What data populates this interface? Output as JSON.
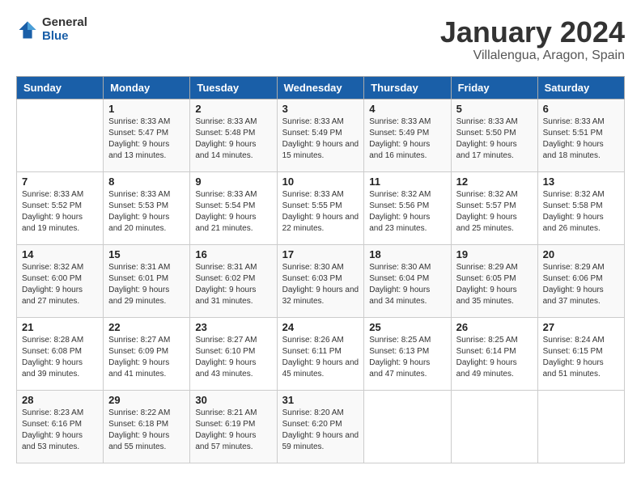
{
  "logo": {
    "text_general": "General",
    "text_blue": "Blue"
  },
  "title": "January 2024",
  "subtitle": "Villalengua, Aragon, Spain",
  "days_header": [
    "Sunday",
    "Monday",
    "Tuesday",
    "Wednesday",
    "Thursday",
    "Friday",
    "Saturday"
  ],
  "weeks": [
    [
      {
        "day": "",
        "sunrise": "",
        "sunset": "",
        "daylight": ""
      },
      {
        "day": "1",
        "sunrise": "Sunrise: 8:33 AM",
        "sunset": "Sunset: 5:47 PM",
        "daylight": "Daylight: 9 hours and 13 minutes."
      },
      {
        "day": "2",
        "sunrise": "Sunrise: 8:33 AM",
        "sunset": "Sunset: 5:48 PM",
        "daylight": "Daylight: 9 hours and 14 minutes."
      },
      {
        "day": "3",
        "sunrise": "Sunrise: 8:33 AM",
        "sunset": "Sunset: 5:49 PM",
        "daylight": "Daylight: 9 hours and 15 minutes."
      },
      {
        "day": "4",
        "sunrise": "Sunrise: 8:33 AM",
        "sunset": "Sunset: 5:49 PM",
        "daylight": "Daylight: 9 hours and 16 minutes."
      },
      {
        "day": "5",
        "sunrise": "Sunrise: 8:33 AM",
        "sunset": "Sunset: 5:50 PM",
        "daylight": "Daylight: 9 hours and 17 minutes."
      },
      {
        "day": "6",
        "sunrise": "Sunrise: 8:33 AM",
        "sunset": "Sunset: 5:51 PM",
        "daylight": "Daylight: 9 hours and 18 minutes."
      }
    ],
    [
      {
        "day": "7",
        "sunrise": "Sunrise: 8:33 AM",
        "sunset": "Sunset: 5:52 PM",
        "daylight": "Daylight: 9 hours and 19 minutes."
      },
      {
        "day": "8",
        "sunrise": "Sunrise: 8:33 AM",
        "sunset": "Sunset: 5:53 PM",
        "daylight": "Daylight: 9 hours and 20 minutes."
      },
      {
        "day": "9",
        "sunrise": "Sunrise: 8:33 AM",
        "sunset": "Sunset: 5:54 PM",
        "daylight": "Daylight: 9 hours and 21 minutes."
      },
      {
        "day": "10",
        "sunrise": "Sunrise: 8:33 AM",
        "sunset": "Sunset: 5:55 PM",
        "daylight": "Daylight: 9 hours and 22 minutes."
      },
      {
        "day": "11",
        "sunrise": "Sunrise: 8:32 AM",
        "sunset": "Sunset: 5:56 PM",
        "daylight": "Daylight: 9 hours and 23 minutes."
      },
      {
        "day": "12",
        "sunrise": "Sunrise: 8:32 AM",
        "sunset": "Sunset: 5:57 PM",
        "daylight": "Daylight: 9 hours and 25 minutes."
      },
      {
        "day": "13",
        "sunrise": "Sunrise: 8:32 AM",
        "sunset": "Sunset: 5:58 PM",
        "daylight": "Daylight: 9 hours and 26 minutes."
      }
    ],
    [
      {
        "day": "14",
        "sunrise": "Sunrise: 8:32 AM",
        "sunset": "Sunset: 6:00 PM",
        "daylight": "Daylight: 9 hours and 27 minutes."
      },
      {
        "day": "15",
        "sunrise": "Sunrise: 8:31 AM",
        "sunset": "Sunset: 6:01 PM",
        "daylight": "Daylight: 9 hours and 29 minutes."
      },
      {
        "day": "16",
        "sunrise": "Sunrise: 8:31 AM",
        "sunset": "Sunset: 6:02 PM",
        "daylight": "Daylight: 9 hours and 31 minutes."
      },
      {
        "day": "17",
        "sunrise": "Sunrise: 8:30 AM",
        "sunset": "Sunset: 6:03 PM",
        "daylight": "Daylight: 9 hours and 32 minutes."
      },
      {
        "day": "18",
        "sunrise": "Sunrise: 8:30 AM",
        "sunset": "Sunset: 6:04 PM",
        "daylight": "Daylight: 9 hours and 34 minutes."
      },
      {
        "day": "19",
        "sunrise": "Sunrise: 8:29 AM",
        "sunset": "Sunset: 6:05 PM",
        "daylight": "Daylight: 9 hours and 35 minutes."
      },
      {
        "day": "20",
        "sunrise": "Sunrise: 8:29 AM",
        "sunset": "Sunset: 6:06 PM",
        "daylight": "Daylight: 9 hours and 37 minutes."
      }
    ],
    [
      {
        "day": "21",
        "sunrise": "Sunrise: 8:28 AM",
        "sunset": "Sunset: 6:08 PM",
        "daylight": "Daylight: 9 hours and 39 minutes."
      },
      {
        "day": "22",
        "sunrise": "Sunrise: 8:27 AM",
        "sunset": "Sunset: 6:09 PM",
        "daylight": "Daylight: 9 hours and 41 minutes."
      },
      {
        "day": "23",
        "sunrise": "Sunrise: 8:27 AM",
        "sunset": "Sunset: 6:10 PM",
        "daylight": "Daylight: 9 hours and 43 minutes."
      },
      {
        "day": "24",
        "sunrise": "Sunrise: 8:26 AM",
        "sunset": "Sunset: 6:11 PM",
        "daylight": "Daylight: 9 hours and 45 minutes."
      },
      {
        "day": "25",
        "sunrise": "Sunrise: 8:25 AM",
        "sunset": "Sunset: 6:13 PM",
        "daylight": "Daylight: 9 hours and 47 minutes."
      },
      {
        "day": "26",
        "sunrise": "Sunrise: 8:25 AM",
        "sunset": "Sunset: 6:14 PM",
        "daylight": "Daylight: 9 hours and 49 minutes."
      },
      {
        "day": "27",
        "sunrise": "Sunrise: 8:24 AM",
        "sunset": "Sunset: 6:15 PM",
        "daylight": "Daylight: 9 hours and 51 minutes."
      }
    ],
    [
      {
        "day": "28",
        "sunrise": "Sunrise: 8:23 AM",
        "sunset": "Sunset: 6:16 PM",
        "daylight": "Daylight: 9 hours and 53 minutes."
      },
      {
        "day": "29",
        "sunrise": "Sunrise: 8:22 AM",
        "sunset": "Sunset: 6:18 PM",
        "daylight": "Daylight: 9 hours and 55 minutes."
      },
      {
        "day": "30",
        "sunrise": "Sunrise: 8:21 AM",
        "sunset": "Sunset: 6:19 PM",
        "daylight": "Daylight: 9 hours and 57 minutes."
      },
      {
        "day": "31",
        "sunrise": "Sunrise: 8:20 AM",
        "sunset": "Sunset: 6:20 PM",
        "daylight": "Daylight: 9 hours and 59 minutes."
      },
      {
        "day": "",
        "sunrise": "",
        "sunset": "",
        "daylight": ""
      },
      {
        "day": "",
        "sunrise": "",
        "sunset": "",
        "daylight": ""
      },
      {
        "day": "",
        "sunrise": "",
        "sunset": "",
        "daylight": ""
      }
    ]
  ]
}
